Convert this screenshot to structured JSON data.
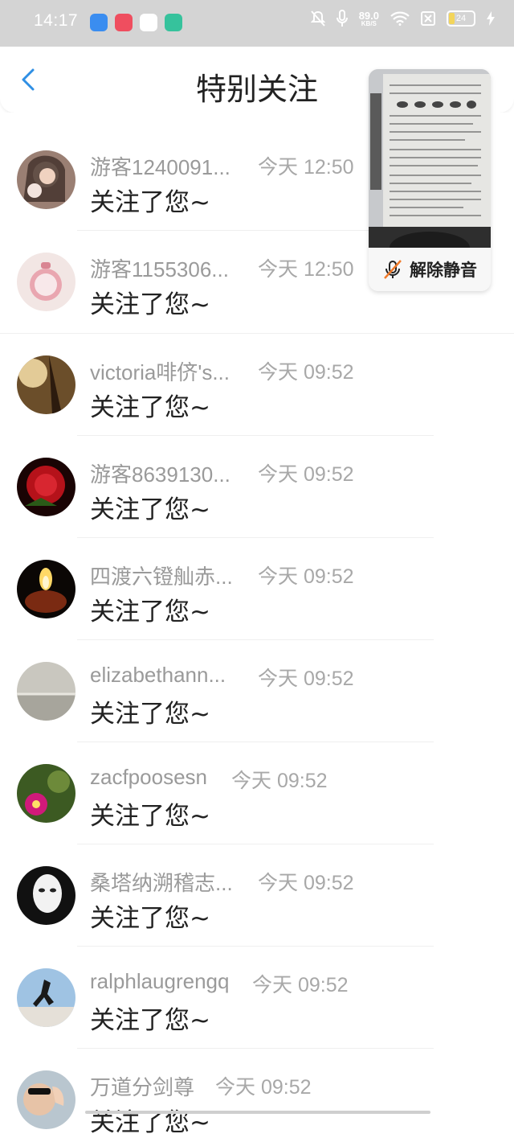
{
  "status": {
    "time": "14:17",
    "net_speed": "89.0",
    "net_unit": "KB/S",
    "battery": "24"
  },
  "header": {
    "title": "特别关注"
  },
  "float_video": {
    "unmute_label": "解除静音"
  },
  "items": [
    {
      "name": "游客1240091...",
      "time": "今天 12:50",
      "message": "关注了您~"
    },
    {
      "name": "游客1155306...",
      "time": "今天 12:50",
      "message": "关注了您~"
    },
    {
      "name": "victoria啡侪's...",
      "time": "今天 09:52",
      "message": "关注了您~"
    },
    {
      "name": "游客8639130...",
      "time": "今天 09:52",
      "message": "关注了您~"
    },
    {
      "name": "四渡六镫舢赤...",
      "time": "今天 09:52",
      "message": "关注了您~"
    },
    {
      "name": "elizabethann...",
      "time": "今天 09:52",
      "message": "关注了您~"
    },
    {
      "name": "zacfpoosesn",
      "time": "今天 09:52",
      "message": "关注了您~"
    },
    {
      "name": "桑塔纳溯稽志...",
      "time": "今天 09:52",
      "message": "关注了您~"
    },
    {
      "name": "ralphlaugrengq",
      "time": "今天 09:52",
      "message": "关注了您~"
    },
    {
      "name": "万道分剑尊",
      "time": "今天 09:52",
      "message": "关注了您~"
    }
  ]
}
